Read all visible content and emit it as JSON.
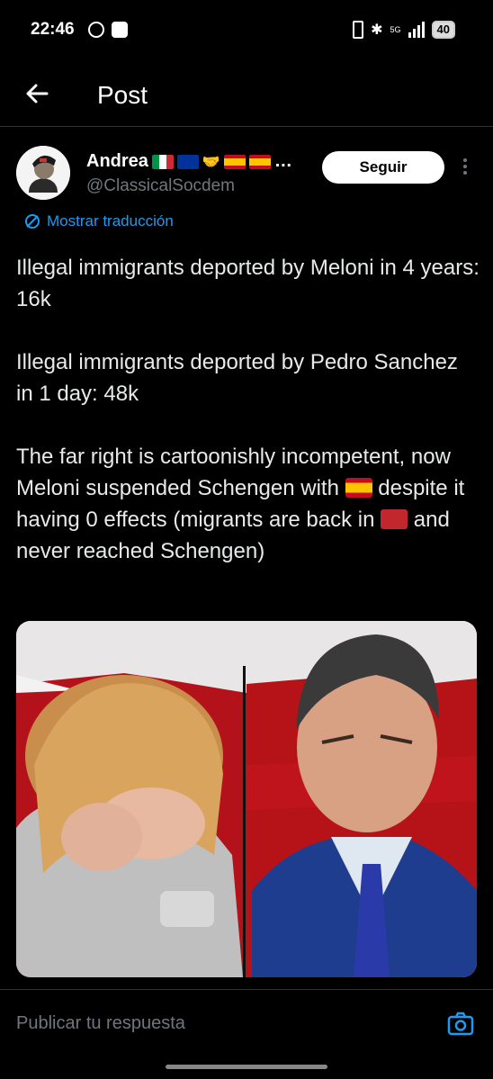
{
  "status_bar": {
    "time": "22:46",
    "battery": "40",
    "network_label": "5G"
  },
  "header": {
    "title": "Post",
    "back_icon": "arrow-left-icon"
  },
  "post": {
    "author_name": "Andrea",
    "author_name_suffix": "…",
    "author_handle": "@ClassicalSocdem",
    "follow_label": "Seguir",
    "translate_label": "Mostrar traducción",
    "paragraphs": {
      "p1": "Illegal immigrants deported by Meloni in 4 years: 16k",
      "p2": "Illegal immigrants deported by Pedro Sanchez in 1 day: 48k",
      "p3_a": "The far right is cartoonishly incompetent, now Meloni suspended Schengen with",
      "p3_b": "despite it having 0 effects (migrants are back in",
      "p3_c": "and never reached Schengen)"
    }
  },
  "reply": {
    "placeholder": "Publicar tu respuesta",
    "camera_icon": "camera-icon"
  },
  "colors": {
    "accent": "#1d9bf0",
    "background": "#000000",
    "muted": "#71767b"
  }
}
